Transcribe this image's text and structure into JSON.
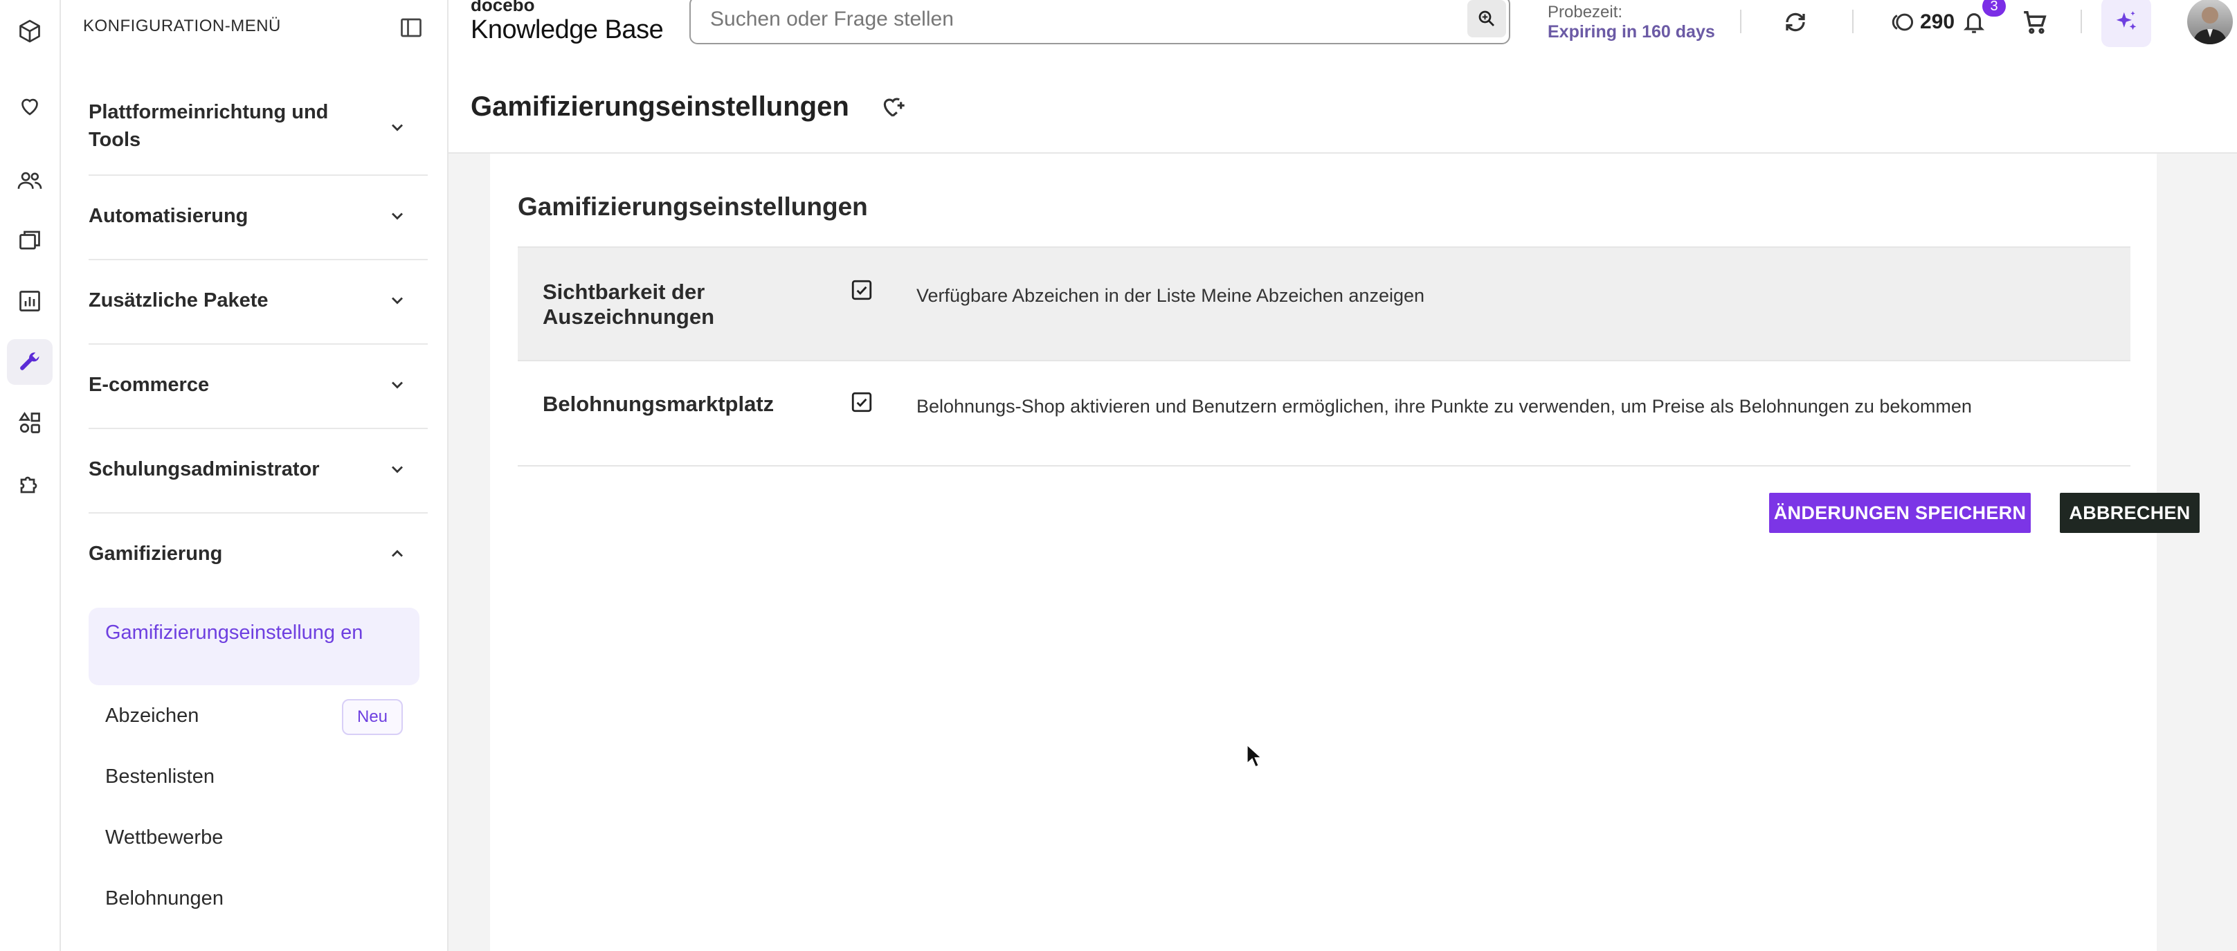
{
  "rail": {
    "items": [
      {
        "icon": "cube-icon",
        "active": false
      },
      {
        "icon": "heart-icon",
        "active": false
      },
      {
        "icon": "users-icon",
        "active": false
      },
      {
        "icon": "courses-icon",
        "active": false
      },
      {
        "icon": "reports-icon",
        "active": false
      },
      {
        "icon": "wrench-icon",
        "active": true
      },
      {
        "icon": "apps-icon",
        "active": false
      },
      {
        "icon": "puzzle-icon",
        "active": false
      }
    ]
  },
  "sidebar": {
    "header": "KONFIGURATION-MENÜ",
    "sections": [
      {
        "label": "Plattformeinrichtung und Tools",
        "expanded": false
      },
      {
        "label": "Automatisierung",
        "expanded": false
      },
      {
        "label": "Zusätzliche Pakete",
        "expanded": false
      },
      {
        "label": "E-commerce",
        "expanded": false
      },
      {
        "label": "Schulungsadministrator",
        "expanded": false
      },
      {
        "label": "Gamifizierung",
        "expanded": true
      }
    ],
    "subitems": [
      {
        "label": "Gamifizierungseinstellung en",
        "active": true
      },
      {
        "label": "Abzeichen",
        "badge": "Neu"
      },
      {
        "label": "Bestenlisten"
      },
      {
        "label": "Wettbewerbe"
      },
      {
        "label": "Belohnungen"
      }
    ]
  },
  "topbar": {
    "brand_small": "docebo",
    "brand_big": "Knowledge Base",
    "search_placeholder": "Suchen oder Frage stellen",
    "trial_label": "Probezeit:",
    "trial_value": "Expiring in 160 days",
    "points": "290",
    "notifications_count": "3"
  },
  "page": {
    "title": "Gamifizierungseinstellungen"
  },
  "card": {
    "title": "Gamifizierungseinstellungen",
    "rows": [
      {
        "label": "Sichtbarkeit der Auszeichnungen",
        "checked": true,
        "description": "Verfügbare Abzeichen in der Liste Meine Abzeichen anzeigen"
      },
      {
        "label": "Belohnungsmarktplatz",
        "checked": true,
        "description": "Belohnungs-Shop aktivieren und Benutzern ermöglichen, ihre Punkte zu verwenden, um Preise als Belohnungen zu bekommen"
      }
    ],
    "save_label": "ÄNDERUNGEN SPEICHERN",
    "cancel_label": "ABBRECHEN"
  },
  "colors": {
    "accent": "#7c35e6",
    "dark_button": "#1f2722",
    "active_text": "#6e3fe0"
  }
}
